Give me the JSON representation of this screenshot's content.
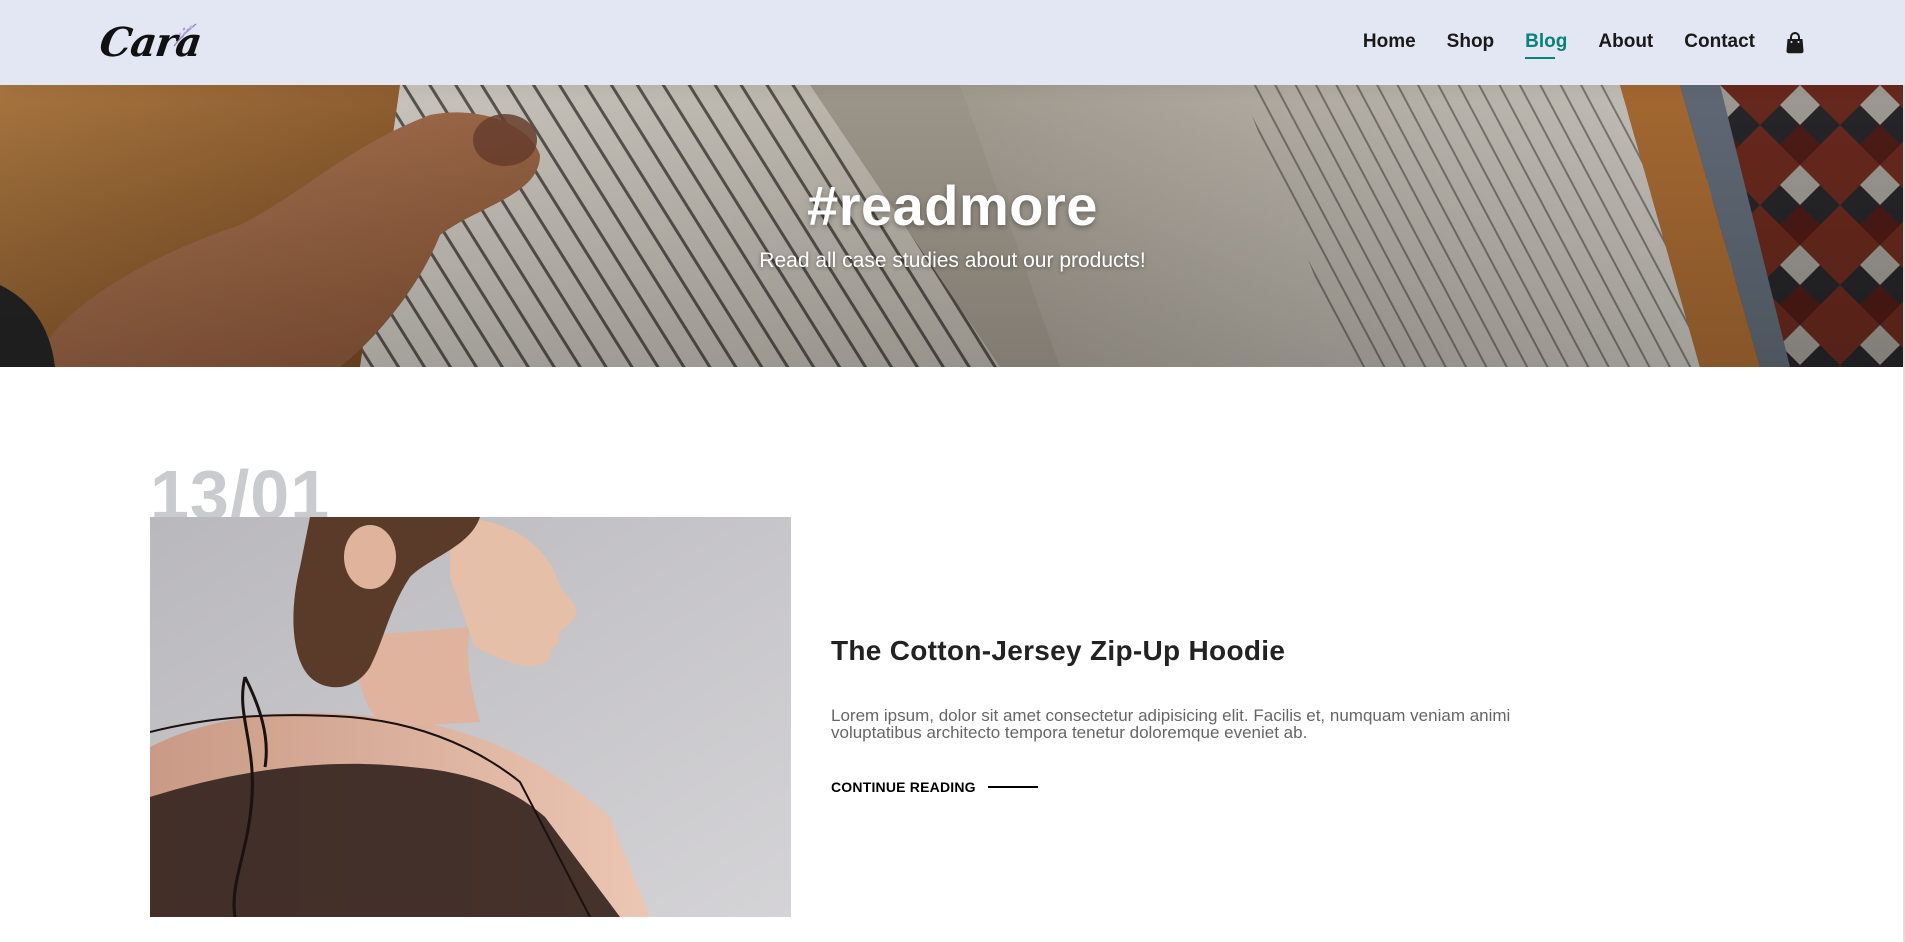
{
  "header": {
    "logo_text": "Cara",
    "nav": [
      {
        "label": "Home",
        "active": false
      },
      {
        "label": "Shop",
        "active": false
      },
      {
        "label": "Blog",
        "active": true
      },
      {
        "label": "About",
        "active": false
      },
      {
        "label": "Contact",
        "active": false
      }
    ],
    "cart_icon": "shopping-bag-icon"
  },
  "hero": {
    "title": "#readmore",
    "subtitle": "Read all case studies about our products!"
  },
  "blog": {
    "posts": [
      {
        "date": "13/01",
        "title": "The Cotton-Jersey Zip-Up Hoodie",
        "excerpt": "Lorem ipsum, dolor sit amet consectetur adipisicing elit. Facilis et, numquam veniam animi voluptatibus architecto tempora tenetur doloremque eveniet ab.",
        "link_label": "CONTINUE READING"
      }
    ]
  },
  "colors": {
    "header_bg": "#e3e6f3",
    "accent": "#088178",
    "date_gray": "#c9cbce",
    "text_dark": "#222222",
    "text_muted": "#666666"
  }
}
